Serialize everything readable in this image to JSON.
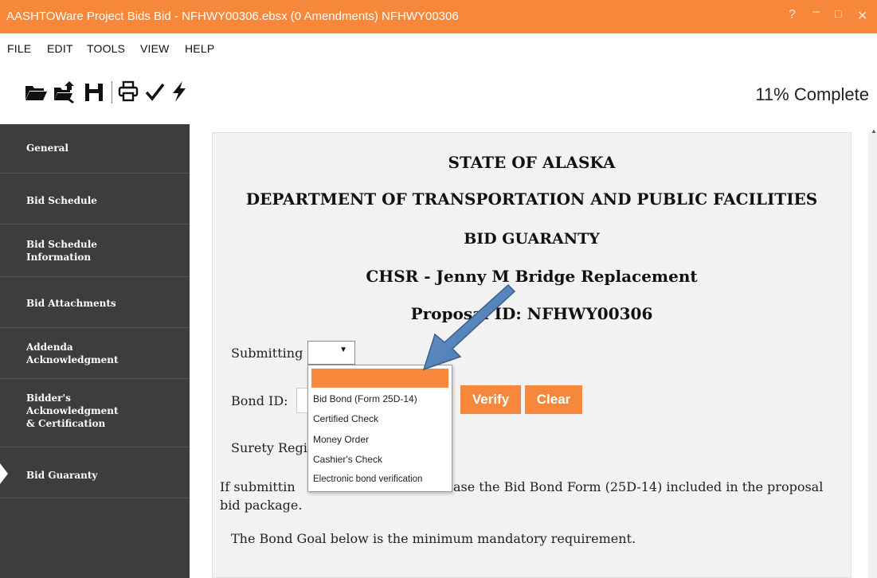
{
  "window": {
    "title": "AASHTOWare Project Bids Bid - NFHWY00306.ebsx (0 Amendments) NFHWY00306",
    "help": "?",
    "minimize": "–",
    "maximize": "□",
    "close": "✕"
  },
  "menu": [
    "FILE",
    "EDIT",
    "TOOLS",
    "VIEW",
    "HELP"
  ],
  "toolbar": {
    "tools": [
      "open-folder-icon",
      "import-icon",
      "save-icon",
      "print-icon",
      "check-icon",
      "lightning-icon"
    ],
    "progress": "11% Complete"
  },
  "sidebar": {
    "items": [
      {
        "label": "General",
        "active": false
      },
      {
        "label": "Bid Schedule",
        "active": false
      },
      {
        "label": "Bid Schedule\nInformation",
        "active": false
      },
      {
        "label": "Bid Attachments",
        "active": false
      },
      {
        "label": "Addenda\nAcknowledgment",
        "active": false
      },
      {
        "label": "Bidder's\nAcknowledgment\n& Certification",
        "active": false
      },
      {
        "label": "Bid Guaranty",
        "active": true
      }
    ]
  },
  "main": {
    "heading1": "STATE OF ALASKA",
    "heading2": "DEPARTMENT OF TRANSPORTATION AND PUBLIC FACILITIES",
    "heading3": "BID GUARANTY",
    "heading4": "CHSR - Jenny M Bridge Replacement",
    "heading5": "Proposal ID: NFHWY00306",
    "submitting_label": "Submitting",
    "submitting_value": "",
    "bond_id_label": "Bond ID:",
    "bond_id_value": "",
    "verify_label": "Verify",
    "clear_label": "Clear",
    "surety_label": "Surety Regi",
    "instructions_line1_start": "If submittin",
    "instructions_line1_end": "ase the Bid Bond Form (25D-14) included in the proposal",
    "instructions_line2": "bid package.",
    "bond_goal_text": "The Bond Goal below is the minimum mandatory requirement."
  },
  "dropdown": {
    "options": [
      "",
      "Bid Bond (Form 25D-14)",
      "Certified Check",
      "Money Order",
      "Cashier's Check",
      "Electronic bond verification"
    ],
    "highlighted_index": 0
  },
  "colors": {
    "accent": "#f7873b",
    "sidebar_bg": "#3d3d3f",
    "panel_bg": "#f2f2f2",
    "arrow": "#4a7db8"
  }
}
